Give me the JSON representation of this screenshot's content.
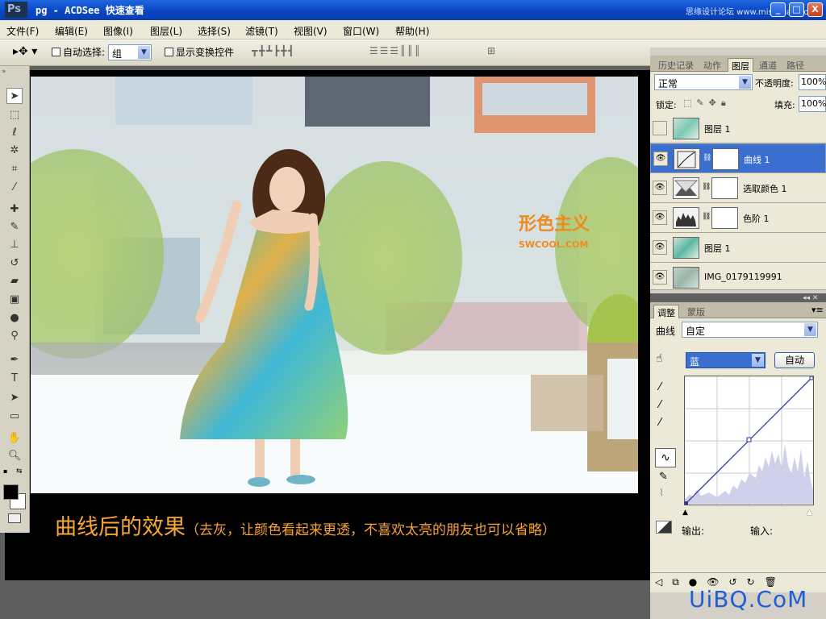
{
  "titlebar": {
    "ps_logo": "Ps",
    "title": "pg - ACDSee 快速查看",
    "watermark": "思缘设计论坛 www.missyuan.com",
    "minimize": "_",
    "maximize": "□",
    "close": "X"
  },
  "menu": [
    "文件(F)",
    "编辑(E)",
    "图像(I)",
    "图层(L)",
    "选择(S)",
    "滤镜(T)",
    "视图(V)",
    "窗口(W)",
    "帮助(H)"
  ],
  "options": {
    "auto_select_label": "自动选择:",
    "auto_select_value": "组",
    "show_transform_label": "显示变换控件"
  },
  "caption": {
    "main": "曲线后的效果",
    "sub": "（去灰，让颜色看起来更透，不喜欢太亮的朋友也可以省略）"
  },
  "photo_watermark": {
    "logo": "形色主义",
    "url": "SWCOOL.COM"
  },
  "panel_tabs": [
    "历史记录",
    "动作",
    "图层",
    "通道",
    "路径"
  ],
  "layers_panel": {
    "blend_mode": "正常",
    "opacity_label": "不透明度:",
    "opacity_value": "100%",
    "lock_label": "锁定:",
    "fill_label": "填充:",
    "fill_value": "100%"
  },
  "layers": [
    {
      "name": "图层 1",
      "visible": false,
      "selected": false,
      "kind": "photo"
    },
    {
      "name": "曲线 1",
      "visible": true,
      "selected": true,
      "kind": "curves"
    },
    {
      "name": "选取颜色 1",
      "visible": true,
      "selected": false,
      "kind": "selective"
    },
    {
      "name": "色阶 1",
      "visible": true,
      "selected": false,
      "kind": "levels"
    },
    {
      "name": "图层 1",
      "visible": true,
      "selected": false,
      "kind": "photo"
    },
    {
      "name": "IMG_0179119991",
      "visible": true,
      "selected": false,
      "kind": "photo"
    }
  ],
  "adjust_tabs": [
    "调整",
    "蒙版"
  ],
  "curves": {
    "label": "曲线",
    "preset": "自定",
    "channel": "蓝",
    "auto_button": "自动",
    "output_label": "输出:",
    "input_label": "输入:"
  },
  "site_watermark": "UiBQ.CoM",
  "colors": {
    "accent_blue": "#3a6fd0",
    "caption_orange": "#f7a734",
    "titlebar_blue": "#0a46c4"
  }
}
